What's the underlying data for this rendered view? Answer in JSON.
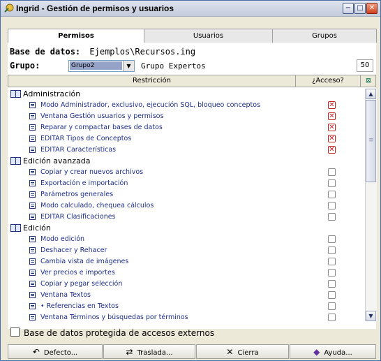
{
  "window": {
    "title": "Ingrid - Gestión de permisos y usuarios",
    "controls": {
      "minimize": "−",
      "restore": "□",
      "close": "✕"
    }
  },
  "tabs": [
    {
      "label": "Permisos",
      "active": true
    },
    {
      "label": "Usuarios",
      "active": false
    },
    {
      "label": "Grupos",
      "active": false
    }
  ],
  "db": {
    "label": "Base de datos:",
    "value": "Ejemplos\\Recursos.ing"
  },
  "group": {
    "label": "Grupo:",
    "selected": "Grupo2",
    "description": "Grupo Expertos",
    "count": "50"
  },
  "table": {
    "header_restriccion": "Restricción",
    "header_acceso": "¿Acceso?",
    "header_icon": "excel-icon"
  },
  "rows": [
    {
      "type": "group",
      "label": "Administración"
    },
    {
      "type": "item",
      "label": "Modo Administrador, exclusivo, ejecución SQL, bloqueo conceptos",
      "checked": true
    },
    {
      "type": "item",
      "label": "Ventana Gestión usuarios y permisos",
      "checked": true
    },
    {
      "type": "item",
      "label": "Reparar y compactar bases de datos",
      "checked": true
    },
    {
      "type": "item",
      "label": "EDITAR Tipos de Conceptos",
      "checked": true
    },
    {
      "type": "item",
      "label": "EDITAR Características",
      "checked": true
    },
    {
      "type": "group",
      "label": "Edición avanzada"
    },
    {
      "type": "item",
      "label": "Copiar y crear nuevos archivos",
      "checked": false
    },
    {
      "type": "item",
      "label": "Exportación e importación",
      "checked": false
    },
    {
      "type": "item",
      "label": "Parámetros generales",
      "checked": false
    },
    {
      "type": "item",
      "label": "Modo calculado, chequea cálculos",
      "checked": false
    },
    {
      "type": "item",
      "label": "EDITAR Clasificaciones",
      "checked": false
    },
    {
      "type": "group",
      "label": "Edición"
    },
    {
      "type": "item",
      "label": "Modo edición",
      "checked": false
    },
    {
      "type": "item",
      "label": "Deshacer y Rehacer",
      "checked": false
    },
    {
      "type": "item",
      "label": "Cambia vista de imágenes",
      "checked": false
    },
    {
      "type": "item",
      "label": "Ver precios e importes",
      "checked": false
    },
    {
      "type": "item",
      "label": "Copiar y pegar selección",
      "checked": false
    },
    {
      "type": "item",
      "label": "Ventana Textos",
      "checked": false
    },
    {
      "type": "item",
      "label": "• Referencias en Textos",
      "checked": false
    },
    {
      "type": "item",
      "label": "Ventana Términos y búsquedas por términos",
      "checked": false
    }
  ],
  "protect": {
    "label": "Base de datos protegida de accesos externos",
    "checked": false
  },
  "buttons": [
    {
      "label": "Defecto...",
      "icon": "↶",
      "icon_name": "undo-icon"
    },
    {
      "label": "Traslada...",
      "icon": "⇄",
      "icon_name": "transfer-icon"
    },
    {
      "label": "Cierra",
      "icon": "✕",
      "icon_name": "close-icon"
    },
    {
      "label": "Ayuda...",
      "icon": "◆",
      "icon_name": "help-book-icon"
    }
  ],
  "colors": {
    "item_text": "#1c2c88",
    "check_mark": "#d02020",
    "selected_bg": "#96a3c9"
  }
}
